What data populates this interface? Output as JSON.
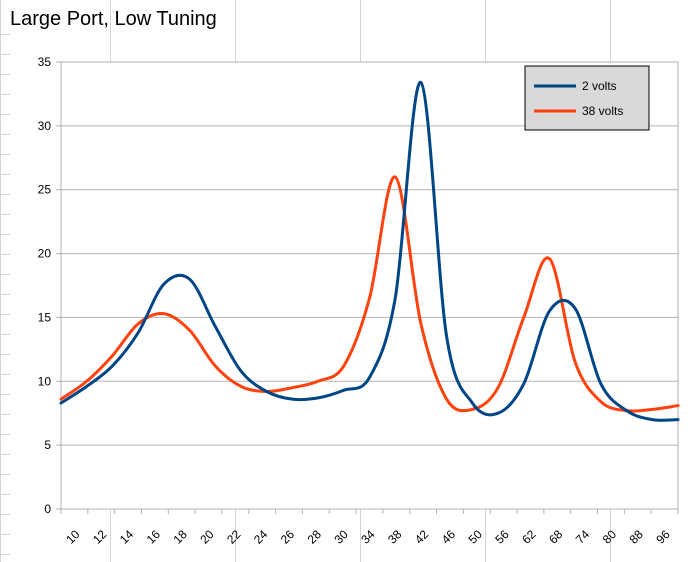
{
  "chart_data": {
    "type": "line",
    "title": "Large Port, Low Tuning",
    "xlabel": "",
    "ylabel": "",
    "ylim": [
      0,
      35
    ],
    "yticks": [
      0,
      5,
      10,
      15,
      20,
      25,
      30,
      35
    ],
    "grid": true,
    "legend_position": "top-right",
    "x_labels": [
      "10",
      "12",
      "14",
      "16",
      "18",
      "20",
      "22",
      "24",
      "26",
      "28",
      "30",
      "34",
      "38",
      "42",
      "46",
      "50",
      "56",
      "62",
      "68",
      "74",
      "80",
      "88",
      "96"
    ],
    "series": [
      {
        "name": "2 volts",
        "color": "#004586",
        "values": [
          8.3,
          9.6,
          11.2,
          13.8,
          17.6,
          18.0,
          14.3,
          10.8,
          9.2,
          8.6,
          8.7,
          9.3,
          10.3,
          16.5,
          33.4,
          13.5,
          8.3,
          7.5,
          9.8,
          15.5,
          15.7,
          9.8,
          7.7,
          7.0,
          7.0
        ]
      },
      {
        "name": "38 volts",
        "color": "#ff420e",
        "values": [
          8.6,
          10.0,
          12.0,
          14.5,
          15.3,
          14.0,
          11.2,
          9.6,
          9.2,
          9.5,
          10.0,
          11.2,
          16.5,
          26.0,
          14.5,
          8.6,
          7.8,
          9.5,
          15.0,
          19.6,
          11.5,
          8.4,
          7.7,
          7.8,
          8.1
        ]
      }
    ]
  }
}
